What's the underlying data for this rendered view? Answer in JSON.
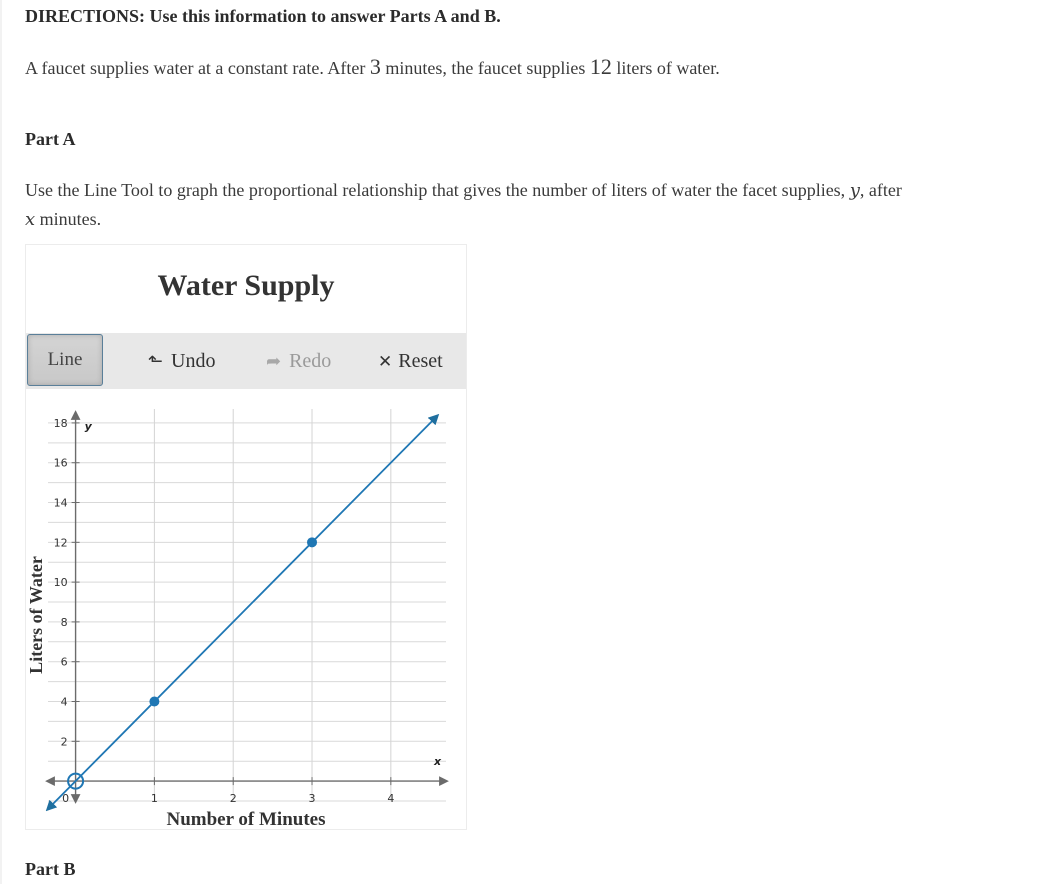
{
  "directions": "DIRECTIONS: Use this information to answer Parts A and B.",
  "intro": {
    "pre": "A faucet supplies water at a constant rate. After ",
    "minutes_value": "3",
    "mid": " minutes, the faucet supplies ",
    "liters_value": "12",
    "post": " liters of water."
  },
  "part_a": {
    "heading": "Part A",
    "prompt_pre": "Use the Line Tool to graph the proportional relationship that gives the number of liters of water the facet supplies, ",
    "var_y": "y",
    "prompt_mid": ", after ",
    "var_x": "x",
    "prompt_post": " minutes."
  },
  "widget": {
    "title": "Water Supply",
    "toolbar": {
      "line_label": "Line",
      "undo_label": "Undo",
      "undo_icon": "undo-arrow-icon",
      "redo_label": "Redo",
      "redo_icon": "redo-arrow-icon",
      "redo_enabled": false,
      "reset_label": "Reset",
      "reset_icon": "close-x-icon",
      "active_tool": "Line"
    }
  },
  "chart_data": {
    "type": "line",
    "title": "Water Supply",
    "xlabel": "Number of Minutes",
    "ylabel": "Liters of Water",
    "x_axis_var": "x",
    "y_axis_var": "y",
    "xlim": [
      -0.35,
      4.7
    ],
    "ylim": [
      -1,
      18.7
    ],
    "x_ticks": [
      0,
      1,
      2,
      3,
      4
    ],
    "x_tick_labels": [
      "0",
      "1",
      "2",
      "3",
      "4"
    ],
    "y_ticks": [
      2,
      4,
      6,
      8,
      10,
      12,
      14,
      16,
      18
    ],
    "y_tick_labels": [
      "2",
      "4",
      "6",
      "8",
      "10",
      "12",
      "14",
      "16",
      "18"
    ],
    "grid": true,
    "x_grid_step": 1,
    "y_grid_step": 1,
    "line_color": "#1f77b4",
    "series": [
      {
        "name": "graphed line",
        "equation": "y = 4x",
        "slope": 4,
        "intercept": 0,
        "points": [
          {
            "x": 1,
            "y": 4
          },
          {
            "x": 3,
            "y": 12
          }
        ],
        "extends_both_directions": true
      }
    ],
    "origin_marker": {
      "x": 0,
      "y": 0,
      "style": "open-circle"
    }
  },
  "part_b": {
    "heading": "Part B"
  }
}
